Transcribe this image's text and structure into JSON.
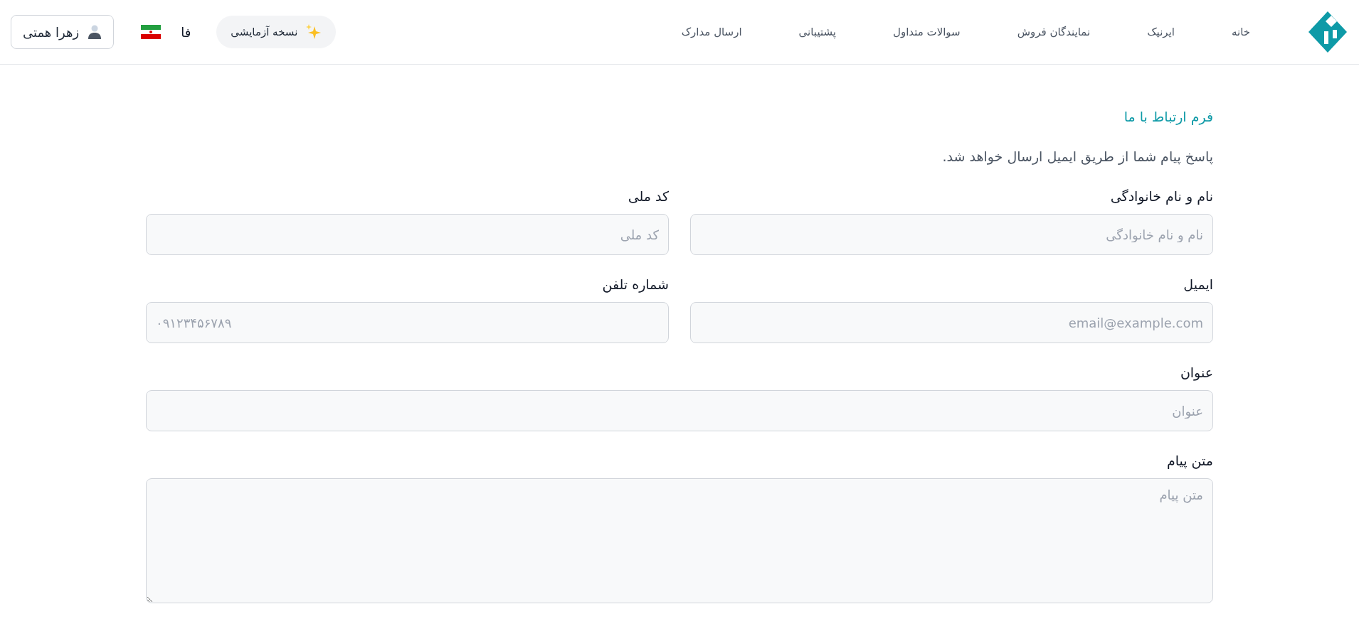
{
  "nav": {
    "links": [
      {
        "label": "خانه"
      },
      {
        "label": "ایرنیک"
      },
      {
        "label": "نمایندگان فروش"
      },
      {
        "label": "سوالات متداول"
      },
      {
        "label": "پشتیبانی"
      },
      {
        "label": "ارسال مدارک"
      }
    ],
    "trial": "نسخه آزمایشی",
    "language": "فا",
    "user": "زهرا همتی"
  },
  "form": {
    "title": "فرم ارتباط با ما",
    "subtitle": "پاسخ پیام شما از طریق ایمیل ارسال خواهد شد.",
    "fields": [
      {
        "kind": "text",
        "label": "نام و نام خانوادگی",
        "placeholder": "نام و نام خانوادگی"
      },
      {
        "kind": "text",
        "label": "کد ملی",
        "placeholder": "کد ملی"
      },
      {
        "kind": "email",
        "label": "ایمیل",
        "placeholder": "email@example.com"
      },
      {
        "kind": "phone",
        "label": "شماره تلفن",
        "placeholder": "۰۹۱۲۳۴۵۶۷۸۹"
      },
      {
        "kind": "wide",
        "label": "عنوان",
        "placeholder": "عنوان"
      },
      {
        "kind": "textarea",
        "label": "متن پیام",
        "placeholder": "متن پیام"
      }
    ]
  }
}
